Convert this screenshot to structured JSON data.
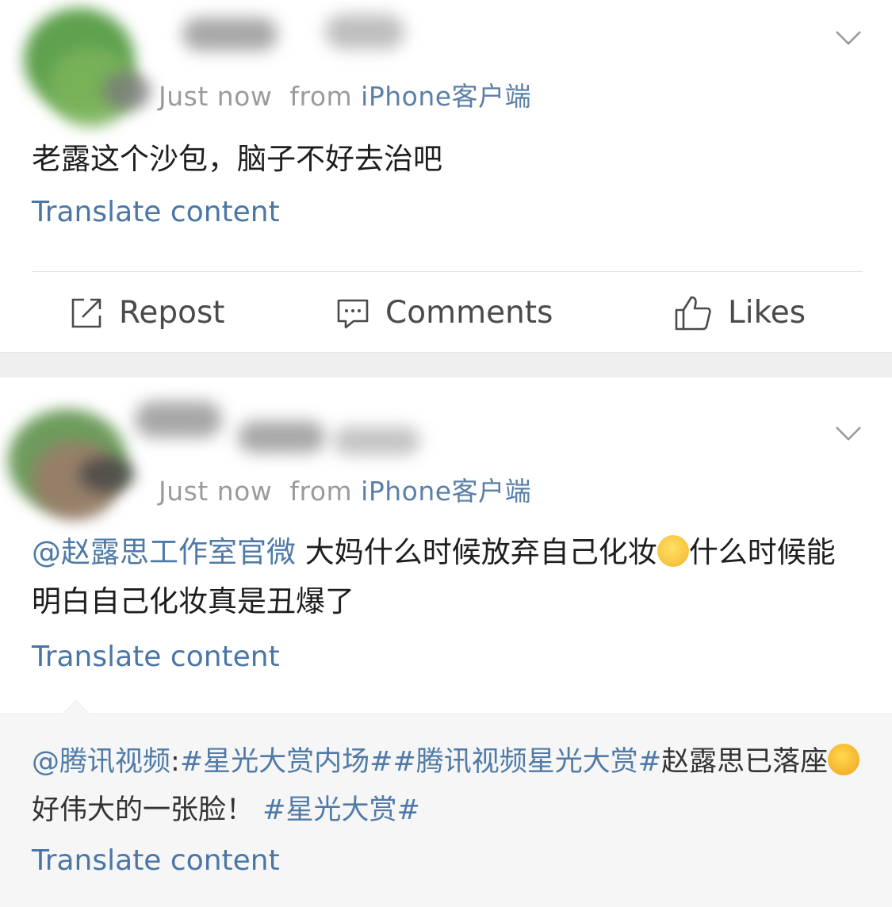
{
  "posts": [
    {
      "time": "Just now",
      "from_label": "from",
      "source": "iPhone客户端",
      "text": "老露这个沙包，脑子不好去治吧",
      "translate": "Translate content",
      "actions": {
        "repost": "Repost",
        "comments": "Comments",
        "likes": "Likes"
      }
    },
    {
      "time": "Just now",
      "from_label": "from",
      "source": "iPhone客户端",
      "mention": "@赵露思工作室官微",
      "text_a": "大妈什么时候放弃自己化妆",
      "text_b": "什么时候能明白自己化妆真是丑爆了",
      "translate": "Translate content",
      "repost": {
        "mention": "@腾讯视频",
        "sep": ":",
        "tags": "#星光大赏内场##腾讯视频星光大赏#",
        "text_a": "赵露思已落座",
        "text_b": "好伟大的一张脸！",
        "tag_end": "#星光大赏#",
        "translate": "Translate content"
      }
    }
  ],
  "colors": {
    "link": "#4f7aa7",
    "meta": "#9b9b9b",
    "band": "#efefef",
    "repost_bg": "#f6f6f6"
  }
}
